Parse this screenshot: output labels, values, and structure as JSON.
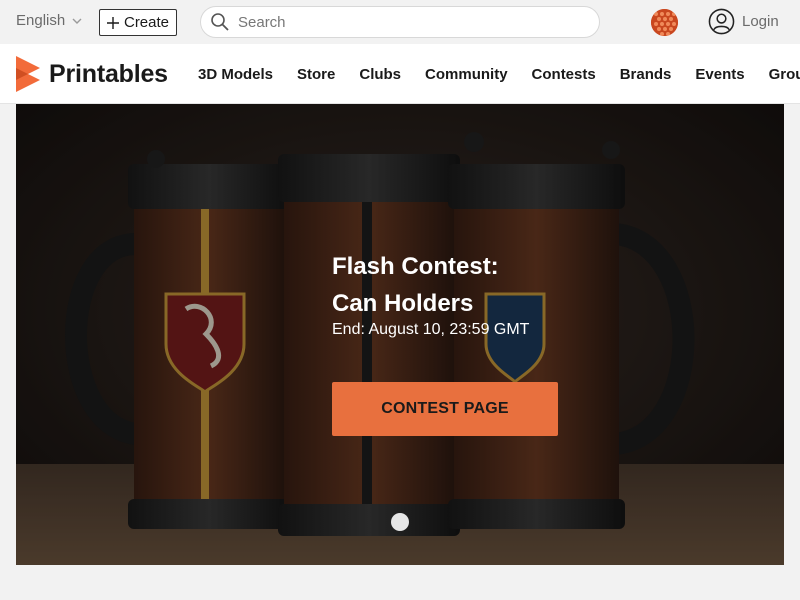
{
  "topbar": {
    "language": "English",
    "create_label": "Create",
    "search_placeholder": "Search",
    "login_label": "Login"
  },
  "brand": {
    "name": "Printables",
    "accent": "#e8703e"
  },
  "nav": {
    "items": [
      {
        "label": "3D Models"
      },
      {
        "label": "Store"
      },
      {
        "label": "Clubs"
      },
      {
        "label": "Community"
      },
      {
        "label": "Contests"
      },
      {
        "label": "Brands"
      },
      {
        "label": "Events"
      },
      {
        "label": "Groups"
      }
    ]
  },
  "hero": {
    "title_line1": "Flash Contest:",
    "title_line2": "Can Holders",
    "subtitle": "End: August 10, 23:59 GMT",
    "button_label": "CONTEST PAGE"
  },
  "icons": [
    "chevron-down-icon",
    "plus-icon",
    "search-icon",
    "user-icon",
    "printables-logo-icon"
  ]
}
